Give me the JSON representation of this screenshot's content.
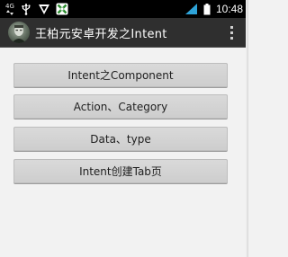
{
  "status_bar": {
    "network_type": "4G",
    "time": "10:48",
    "icons": [
      "usb-icon",
      "notification-shield-icon",
      "app-notification-icon",
      "signal-icon",
      "battery-icon"
    ]
  },
  "action_bar": {
    "title": "王柏元安卓开发之Intent",
    "overflow_icon": "overflow-menu-icon"
  },
  "buttons": [
    {
      "label": "Intent之Component"
    },
    {
      "label": "Action、Category"
    },
    {
      "label": "Data、type"
    },
    {
      "label": "Intent创建Tab页"
    }
  ],
  "colors": {
    "status_bar": "#000000",
    "action_bar": "#2f2f2f",
    "background": "#f2f2f2",
    "button": "#d5d5d5"
  }
}
